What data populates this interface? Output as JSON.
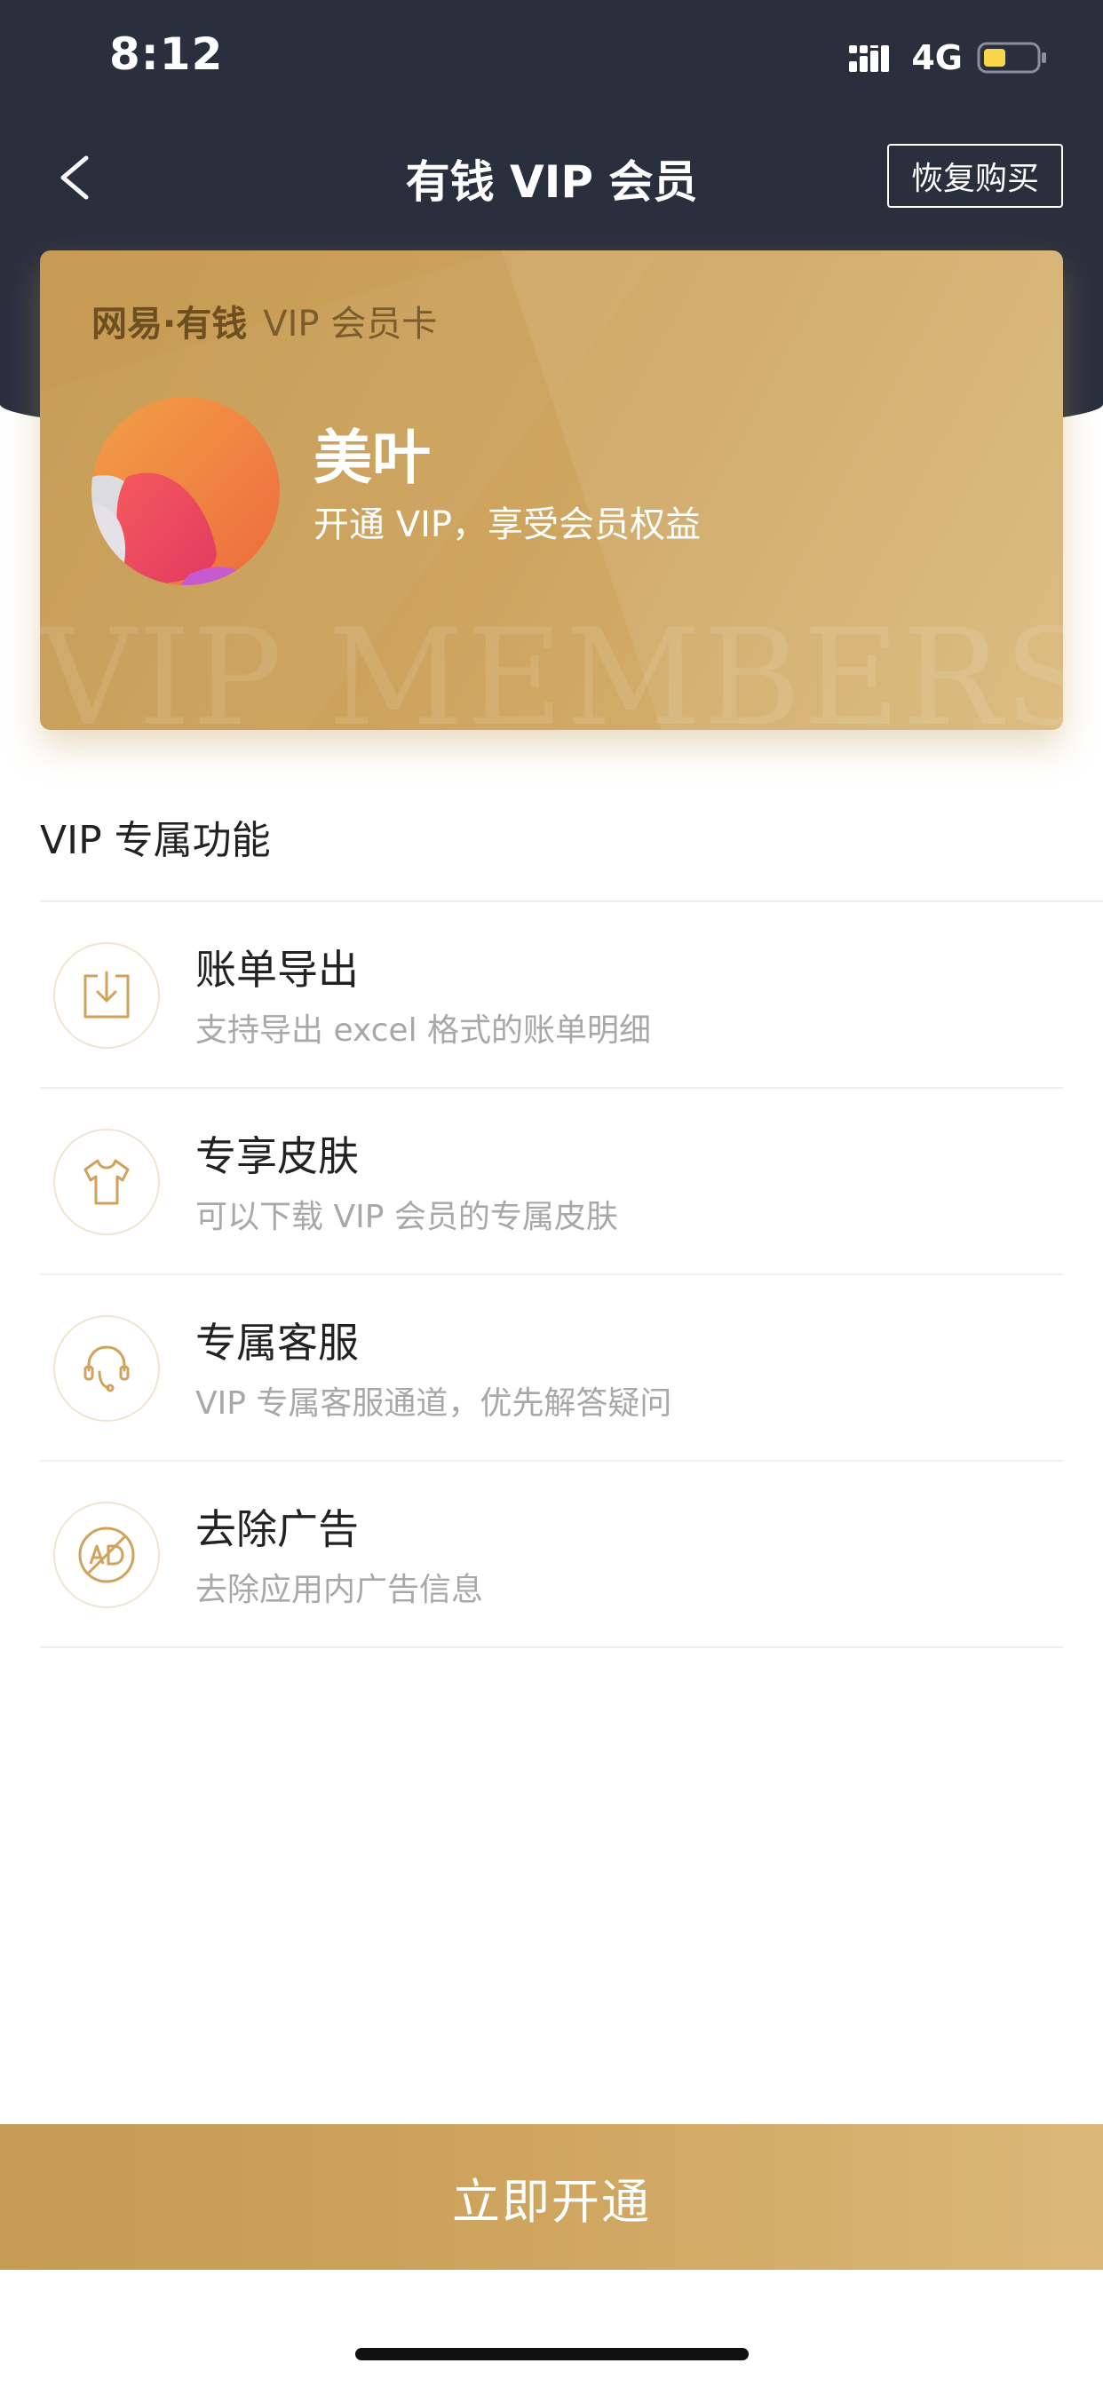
{
  "status_bar": {
    "time": "8:12",
    "network": "4G"
  },
  "nav": {
    "title": "有钱 VIP 会员",
    "restore_label": "恢复购买"
  },
  "card": {
    "brand": "网易·有钱",
    "card_type": "VIP 会员卡",
    "user_name": "美叶",
    "user_subtitle": "开通 VIP，享受会员权益",
    "watermark": "VIP MEMBERS"
  },
  "section": {
    "title": "VIP 专属功能"
  },
  "features": [
    {
      "title": "账单导出",
      "desc": "支持导出 excel 格式的账单明细",
      "icon": "export-icon"
    },
    {
      "title": "专享皮肤",
      "desc": "可以下载 VIP 会员的专属皮肤",
      "icon": "tshirt-icon"
    },
    {
      "title": "专属客服",
      "desc": "VIP 专属客服通道，优先解答疑问",
      "icon": "headset-icon"
    },
    {
      "title": "去除广告",
      "desc": "去除应用内广告信息",
      "icon": "no-ad-icon"
    }
  ],
  "cta": {
    "label": "立即开通"
  },
  "colors": {
    "header_bg": "#2a2f3e",
    "gold": "#c9a05a",
    "icon_stroke": "#d1a25c"
  }
}
